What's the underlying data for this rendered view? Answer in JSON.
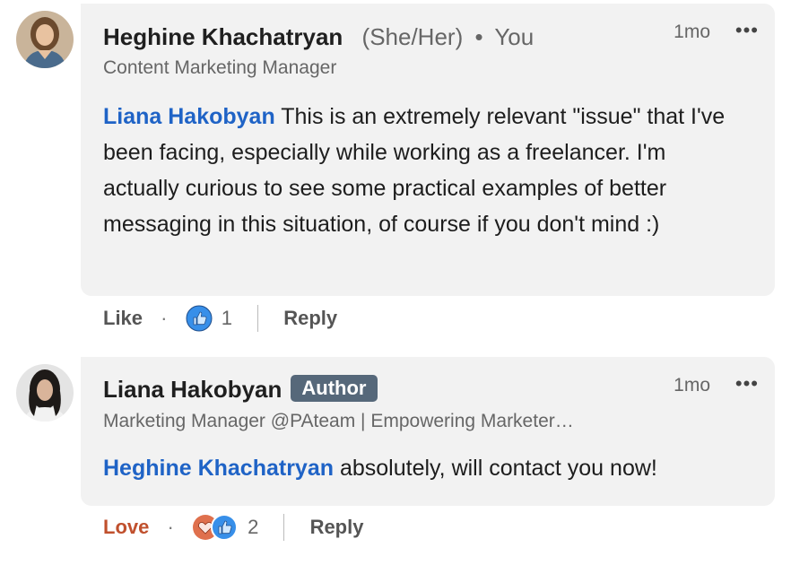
{
  "comments": [
    {
      "author": "Heghine Khachatryan",
      "pronouns": "(She/Her)",
      "you_label": "You",
      "headline": "Content Marketing Manager",
      "time": "1mo",
      "more": "•••",
      "mention": "Liana Hakobyan",
      "text": " This is an extremely relevant \"issue\" that I've been facing, especially while working as a freelancer. I'm actually curious to see some practical examples of better messaging in this situation, of course if you don't mind :)",
      "reaction_label": "Like",
      "reaction_count": "1",
      "reply_label": "Reply"
    },
    {
      "author": "Liana Hakobyan",
      "badge": "Author",
      "headline": "Marketing Manager @PAteam | Empowering Marketer…",
      "time": "1mo",
      "more": "•••",
      "mention": "Heghine Khachatryan",
      "text": " absolutely, will contact you now!",
      "reaction_label": "Love",
      "reaction_count": "2",
      "reply_label": "Reply"
    }
  ],
  "colors": {
    "mention": "#1f63c6",
    "love": "#c0502d",
    "bubble": "#f2f2f2",
    "badge": "#56687a"
  }
}
